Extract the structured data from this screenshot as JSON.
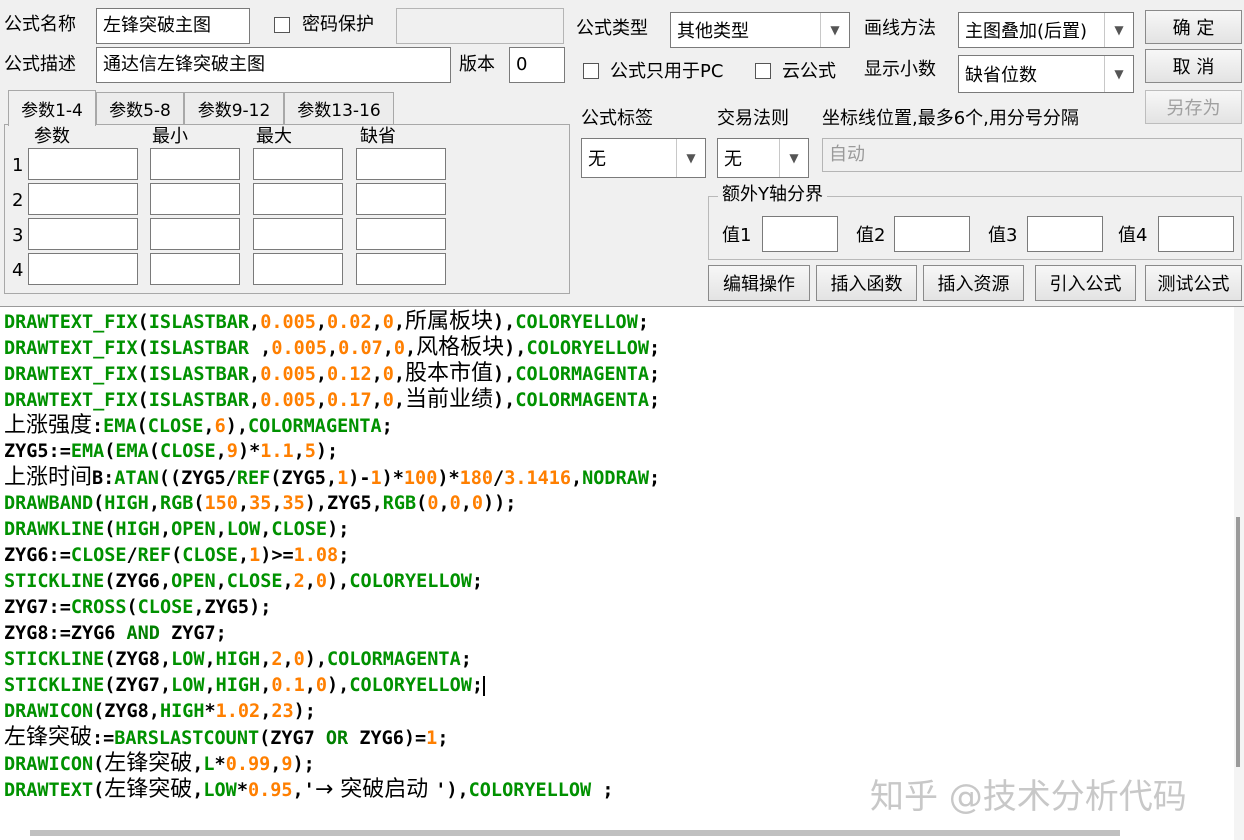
{
  "form": {
    "formula_name_label": "公式名称",
    "formula_name_value": "左锋突破主图",
    "password_protect_label": "密码保护",
    "password_value": "",
    "formula_desc_label": "公式描述",
    "formula_desc_value": "通达信左锋突破主图",
    "version_label": "版本",
    "version_value": "0",
    "formula_type_label": "公式类型",
    "formula_type_value": "其他类型",
    "draw_method_label": "画线方法",
    "draw_method_value": "主图叠加(后置)",
    "pc_only_label": "公式只用于PC",
    "cloud_label": "云公式",
    "decimal_label": "显示小数",
    "decimal_value": "缺省位数",
    "formula_tag_label": "公式标签",
    "formula_tag_value": "无",
    "trade_rule_label": "交易法则",
    "trade_rule_value": "无",
    "axis_pos_label": "坐标线位置,最多6个,用分号分隔",
    "axis_pos_value": "自动",
    "y_axis_group_label": "额外Y轴分界",
    "y_values": [
      "值1",
      "值2",
      "值3",
      "值4"
    ]
  },
  "buttons": {
    "ok": "确 定",
    "cancel": "取 消",
    "save_as": "另存为",
    "edit_ops": "编辑操作",
    "insert_func": "插入函数",
    "insert_res": "插入资源",
    "import_formula": "引入公式",
    "test_formula": "测试公式"
  },
  "tabs": [
    "参数1-4",
    "参数5-8",
    "参数9-12",
    "参数13-16"
  ],
  "param_table": {
    "headers": [
      "参数",
      "最小",
      "最大",
      "缺省"
    ],
    "rows": [
      "1",
      "2",
      "3",
      "4"
    ]
  },
  "code_lines": [
    [
      [
        "f",
        "DRAWTEXT_FIX"
      ],
      [
        "c",
        "("
      ],
      [
        "f",
        "ISLASTBAR"
      ],
      [
        "c",
        ","
      ],
      [
        "n",
        "0.005"
      ],
      [
        "c",
        ","
      ],
      [
        "n",
        "0.02"
      ],
      [
        "c",
        ","
      ],
      [
        "n",
        "0"
      ],
      [
        "c",
        ","
      ],
      [
        "s",
        "所属板块"
      ],
      [
        "c",
        "),"
      ],
      [
        "f",
        "COLORYELLOW"
      ],
      [
        "c",
        ";"
      ]
    ],
    [
      [
        "f",
        "DRAWTEXT_FIX"
      ],
      [
        "c",
        "("
      ],
      [
        "f",
        "ISLASTBAR"
      ],
      [
        "c",
        " ,"
      ],
      [
        "n",
        "0.005"
      ],
      [
        "c",
        ","
      ],
      [
        "n",
        "0.07"
      ],
      [
        "c",
        ","
      ],
      [
        "n",
        "0"
      ],
      [
        "c",
        ","
      ],
      [
        "s",
        "风格板块"
      ],
      [
        "c",
        "),"
      ],
      [
        "f",
        "COLORYELLOW"
      ],
      [
        "c",
        ";"
      ]
    ],
    [
      [
        "f",
        "DRAWTEXT_FIX"
      ],
      [
        "c",
        "("
      ],
      [
        "f",
        "ISLASTBAR"
      ],
      [
        "c",
        ","
      ],
      [
        "n",
        "0.005"
      ],
      [
        "c",
        ","
      ],
      [
        "n",
        "0.12"
      ],
      [
        "c",
        ","
      ],
      [
        "n",
        "0"
      ],
      [
        "c",
        ","
      ],
      [
        "s",
        "股本市值"
      ],
      [
        "c",
        "),"
      ],
      [
        "f",
        "COLORMAGENTA"
      ],
      [
        "c",
        ";"
      ]
    ],
    [
      [
        "f",
        "DRAWTEXT_FIX"
      ],
      [
        "c",
        "("
      ],
      [
        "f",
        "ISLASTBAR"
      ],
      [
        "c",
        ","
      ],
      [
        "n",
        "0.005"
      ],
      [
        "c",
        ","
      ],
      [
        "n",
        "0.17"
      ],
      [
        "c",
        ","
      ],
      [
        "n",
        "0"
      ],
      [
        "c",
        ","
      ],
      [
        "s",
        "当前业绩"
      ],
      [
        "c",
        "),"
      ],
      [
        "f",
        "COLORMAGENTA"
      ],
      [
        "c",
        ";"
      ]
    ],
    [
      [
        "s",
        "上涨强度"
      ],
      [
        "c",
        ":"
      ],
      [
        "f",
        "EMA"
      ],
      [
        "c",
        "("
      ],
      [
        "f",
        "CLOSE"
      ],
      [
        "c",
        ","
      ],
      [
        "n",
        "6"
      ],
      [
        "c",
        "),"
      ],
      [
        "f",
        "COLORMAGENTA"
      ],
      [
        "c",
        ";"
      ]
    ],
    [
      [
        "c",
        "ZYG5:="
      ],
      [
        "f",
        "EMA"
      ],
      [
        "c",
        "("
      ],
      [
        "f",
        "EMA"
      ],
      [
        "c",
        "("
      ],
      [
        "f",
        "CLOSE"
      ],
      [
        "c",
        ","
      ],
      [
        "n",
        "9"
      ],
      [
        "c",
        ")*"
      ],
      [
        "n",
        "1.1"
      ],
      [
        "c",
        ","
      ],
      [
        "n",
        "5"
      ],
      [
        "c",
        ");"
      ]
    ],
    [
      [
        "s",
        "上涨时间"
      ],
      [
        "c",
        "B:"
      ],
      [
        "f",
        "ATAN"
      ],
      [
        "c",
        "((ZYG5/"
      ],
      [
        "f",
        "REF"
      ],
      [
        "c",
        "(ZYG5,"
      ],
      [
        "n",
        "1"
      ],
      [
        "c",
        ")-"
      ],
      [
        "n",
        "1"
      ],
      [
        "c",
        ")*"
      ],
      [
        "n",
        "100"
      ],
      [
        "c",
        ")*"
      ],
      [
        "n",
        "180"
      ],
      [
        "c",
        "/"
      ],
      [
        "n",
        "3.1416"
      ],
      [
        "c",
        ","
      ],
      [
        "f",
        "NODRAW"
      ],
      [
        "c",
        ";"
      ]
    ],
    [
      [
        "f",
        "DRAWBAND"
      ],
      [
        "c",
        "("
      ],
      [
        "f",
        "HIGH"
      ],
      [
        "c",
        ","
      ],
      [
        "f",
        "RGB"
      ],
      [
        "c",
        "("
      ],
      [
        "n",
        "150"
      ],
      [
        "c",
        ","
      ],
      [
        "n",
        "35"
      ],
      [
        "c",
        ","
      ],
      [
        "n",
        "35"
      ],
      [
        "c",
        "),ZYG5,"
      ],
      [
        "f",
        "RGB"
      ],
      [
        "c",
        "("
      ],
      [
        "n",
        "0"
      ],
      [
        "c",
        ","
      ],
      [
        "n",
        "0"
      ],
      [
        "c",
        ","
      ],
      [
        "n",
        "0"
      ],
      [
        "c",
        "));"
      ]
    ],
    [
      [
        "f",
        "DRAWKLINE"
      ],
      [
        "c",
        "("
      ],
      [
        "f",
        "HIGH"
      ],
      [
        "c",
        ","
      ],
      [
        "f",
        "OPEN"
      ],
      [
        "c",
        ","
      ],
      [
        "f",
        "LOW"
      ],
      [
        "c",
        ","
      ],
      [
        "f",
        "CLOSE"
      ],
      [
        "c",
        ");"
      ]
    ],
    [
      [
        "c",
        "ZYG6:="
      ],
      [
        "f",
        "CLOSE"
      ],
      [
        "c",
        "/"
      ],
      [
        "f",
        "REF"
      ],
      [
        "c",
        "("
      ],
      [
        "f",
        "CLOSE"
      ],
      [
        "c",
        ","
      ],
      [
        "n",
        "1"
      ],
      [
        "c",
        ")>="
      ],
      [
        "n",
        "1.08"
      ],
      [
        "c",
        ";"
      ]
    ],
    [
      [
        "f",
        "STICKLINE"
      ],
      [
        "c",
        "(ZYG6,"
      ],
      [
        "f",
        "OPEN"
      ],
      [
        "c",
        ","
      ],
      [
        "f",
        "CLOSE"
      ],
      [
        "c",
        ","
      ],
      [
        "n",
        "2"
      ],
      [
        "c",
        ","
      ],
      [
        "n",
        "0"
      ],
      [
        "c",
        "),"
      ],
      [
        "f",
        "COLORYELLOW"
      ],
      [
        "c",
        ";"
      ]
    ],
    [
      [
        "c",
        "ZYG7:="
      ],
      [
        "f",
        "CROSS"
      ],
      [
        "c",
        "("
      ],
      [
        "f",
        "CLOSE"
      ],
      [
        "c",
        ",ZYG5);"
      ]
    ],
    [
      [
        "c",
        "ZYG8:=ZYG6 "
      ],
      [
        "k",
        "AND"
      ],
      [
        "c",
        " ZYG7;"
      ]
    ],
    [
      [
        "f",
        "STICKLINE"
      ],
      [
        "c",
        "(ZYG8,"
      ],
      [
        "f",
        "LOW"
      ],
      [
        "c",
        ","
      ],
      [
        "f",
        "HIGH"
      ],
      [
        "c",
        ","
      ],
      [
        "n",
        "2"
      ],
      [
        "c",
        ","
      ],
      [
        "n",
        "0"
      ],
      [
        "c",
        "),"
      ],
      [
        "f",
        "COLORMAGENTA"
      ],
      [
        "c",
        ";"
      ]
    ],
    [
      [
        "f",
        "STICKLINE"
      ],
      [
        "c",
        "(ZYG7,"
      ],
      [
        "f",
        "LOW"
      ],
      [
        "c",
        ","
      ],
      [
        "f",
        "HIGH"
      ],
      [
        "c",
        ","
      ],
      [
        "n",
        "0.1"
      ],
      [
        "c",
        ","
      ],
      [
        "n",
        "0"
      ],
      [
        "c",
        "),"
      ],
      [
        "f",
        "COLORYELLOW"
      ],
      [
        "c",
        ";"
      ]
    ],
    [
      [
        "f",
        "DRAWICON"
      ],
      [
        "c",
        "(ZYG8,"
      ],
      [
        "f",
        "HIGH"
      ],
      [
        "c",
        "*"
      ],
      [
        "n",
        "1.02"
      ],
      [
        "c",
        ","
      ],
      [
        "n",
        "23"
      ],
      [
        "c",
        ");"
      ]
    ],
    [
      [
        "s",
        "左锋突破"
      ],
      [
        "c",
        ":="
      ],
      [
        "f",
        "BARSLASTCOUNT"
      ],
      [
        "c",
        "(ZYG7 "
      ],
      [
        "k",
        "OR"
      ],
      [
        "c",
        " ZYG6)="
      ],
      [
        "n",
        "1"
      ],
      [
        "c",
        ";"
      ]
    ],
    [
      [
        "f",
        "DRAWICON"
      ],
      [
        "c",
        "("
      ],
      [
        "s",
        "左锋突破"
      ],
      [
        "c",
        ","
      ],
      [
        "f",
        "L"
      ],
      [
        "c",
        "*"
      ],
      [
        "n",
        "0.99"
      ],
      [
        "c",
        ","
      ],
      [
        "n",
        "9"
      ],
      [
        "c",
        ");"
      ]
    ],
    [
      [
        "f",
        "DRAWTEXT"
      ],
      [
        "c",
        "("
      ],
      [
        "s",
        "左锋突破"
      ],
      [
        "c",
        ","
      ],
      [
        "f",
        "LOW"
      ],
      [
        "c",
        "*"
      ],
      [
        "n",
        "0.95"
      ],
      [
        "c",
        ",'"
      ],
      [
        "s",
        "→ 突破启动 "
      ],
      [
        "c",
        "'),"
      ],
      [
        "f",
        "COLORYELLOW"
      ],
      [
        "c",
        " ;"
      ]
    ]
  ],
  "watermark": "知乎 @技术分析代码",
  "colors": {
    "func": "#009100",
    "number": "#ff7f00",
    "keyword": "#008000",
    "plain": "#000000"
  }
}
